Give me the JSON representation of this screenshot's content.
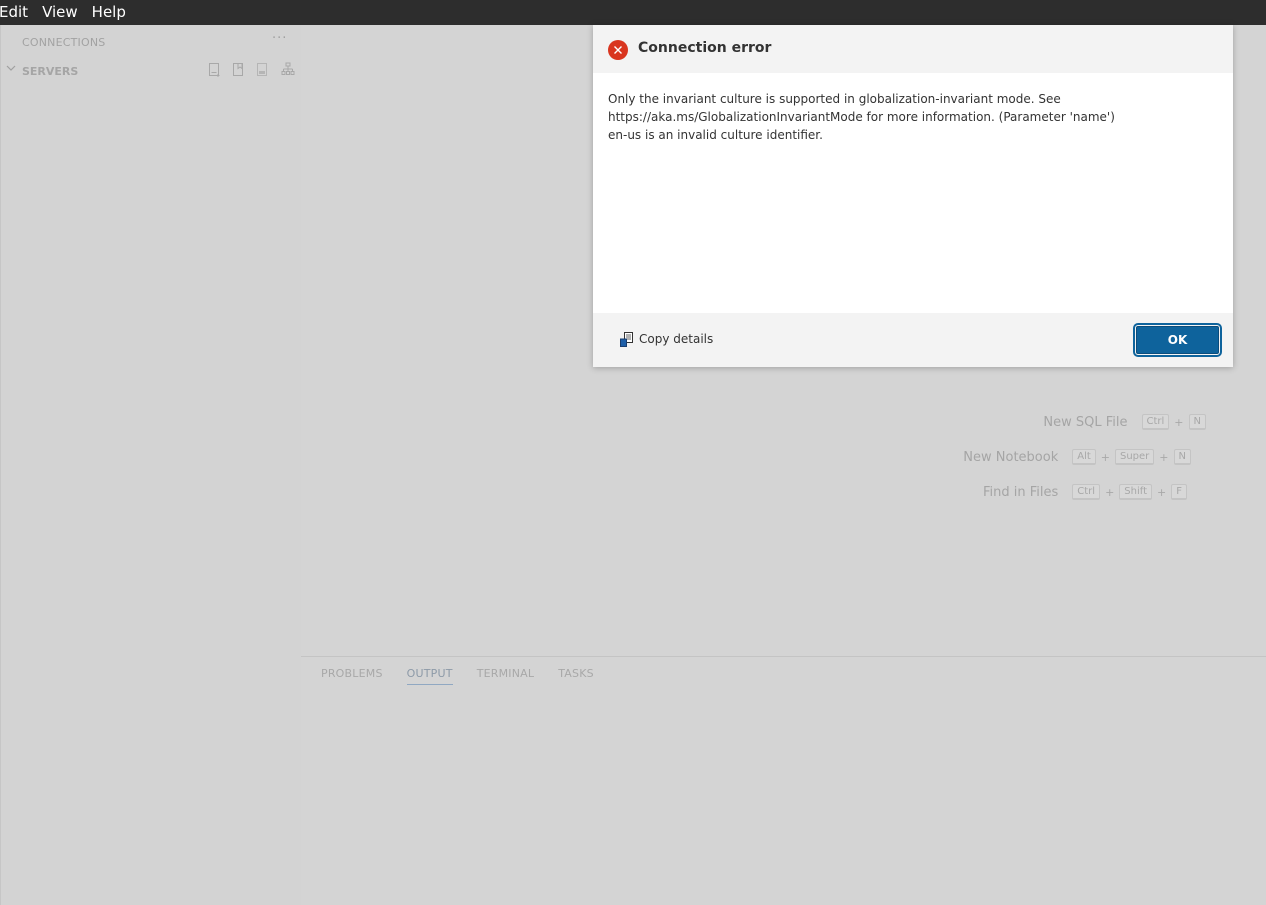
{
  "menubar": {
    "items": [
      "Edit",
      "View",
      "Help"
    ]
  },
  "sidebar": {
    "header": "CONNECTIONS",
    "more": "···",
    "servers_label": "SERVERS",
    "actions": [
      "new-connection-icon",
      "new-server-group-icon",
      "show-active-connections-icon",
      "disconnect-icon"
    ]
  },
  "editor": {
    "shortcuts": [
      {
        "label": "New SQL File",
        "keys": [
          "Ctrl",
          "N"
        ]
      },
      {
        "label": "New Notebook",
        "keys": [
          "Alt",
          "Super",
          "N"
        ]
      },
      {
        "label": "Find in Files",
        "keys": [
          "Ctrl",
          "Shift",
          "F"
        ]
      }
    ]
  },
  "panel": {
    "tabs": [
      {
        "label": "PROBLEMS",
        "active": false
      },
      {
        "label": "OUTPUT",
        "active": true
      },
      {
        "label": "TERMINAL",
        "active": false
      },
      {
        "label": "TASKS",
        "active": false
      }
    ]
  },
  "dialog": {
    "title": "Connection error",
    "message_lines": [
      "Only the invariant culture is supported in globalization-invariant mode. See",
      "https://aka.ms/GlobalizationInvariantMode for more information. (Parameter 'name')",
      "en-us is an invalid culture identifier."
    ],
    "copy_details_label": "Copy details",
    "ok_label": "OK",
    "error_color": "#d9351f",
    "button_color": "#0e639c"
  }
}
